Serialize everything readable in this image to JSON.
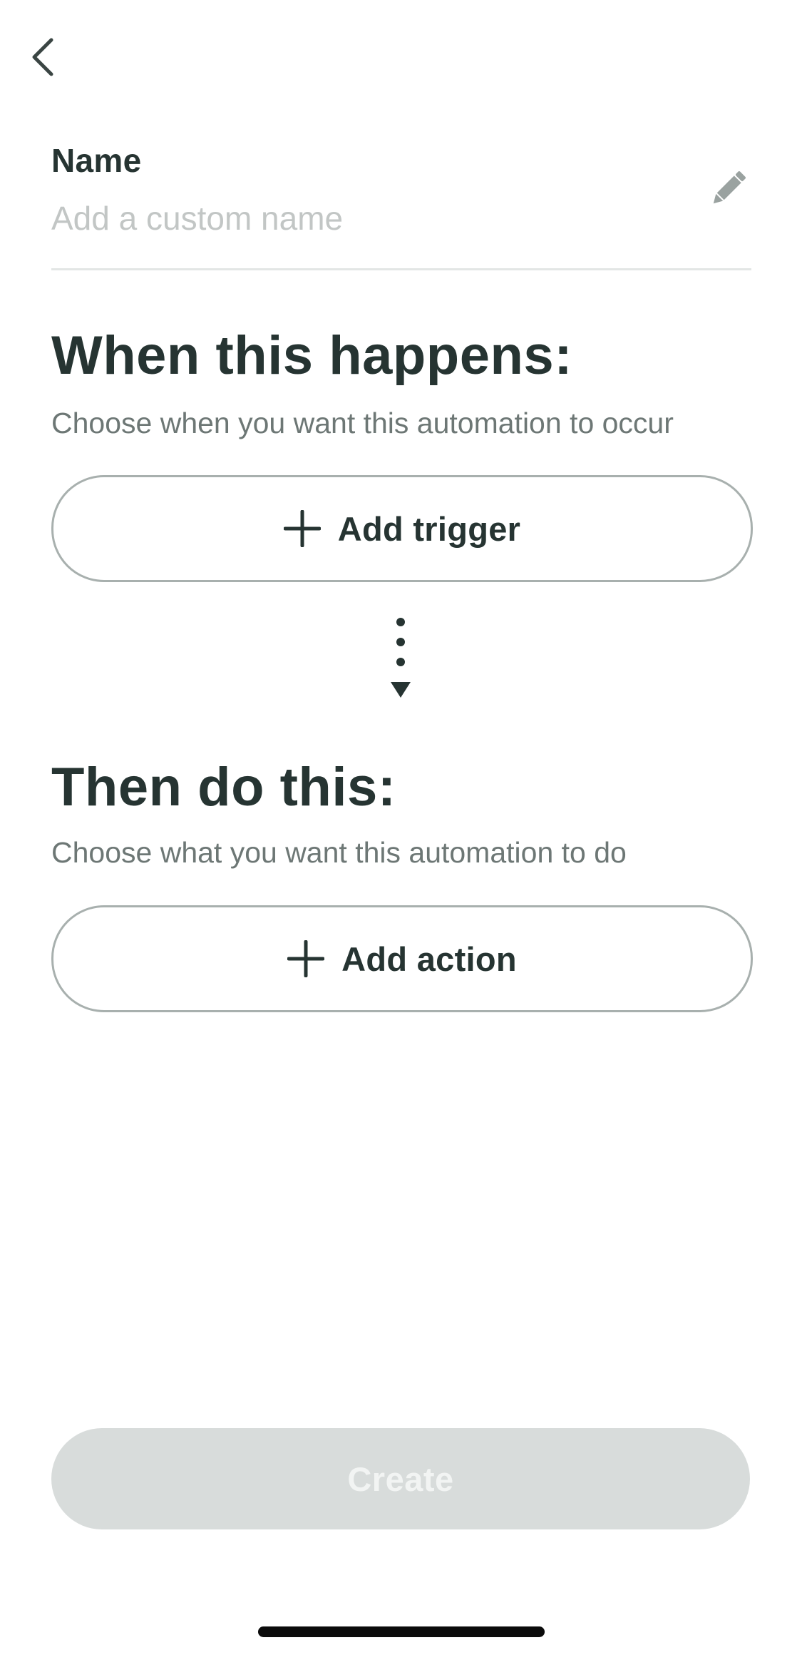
{
  "header": {
    "back_icon": "chevron-left-icon"
  },
  "name_field": {
    "label": "Name",
    "value": "",
    "placeholder": "Add a custom name",
    "edit_icon": "pencil-icon"
  },
  "trigger_section": {
    "heading": "When this happens:",
    "description": "Choose when you want this automation to occur",
    "button_label": "Add trigger",
    "button_icon": "plus-icon"
  },
  "flow_icon": "dotted-arrow-down-icon",
  "action_section": {
    "heading": "Then do this:",
    "description": "Choose what you want this automation to do",
    "button_label": "Add action",
    "button_icon": "plus-icon"
  },
  "footer": {
    "create_label": "Create",
    "create_enabled": false
  },
  "colors": {
    "text_primary": "#263432",
    "text_secondary": "#6d7775",
    "placeholder": "#c2c6c5",
    "button_border": "#a8b0ae",
    "disabled_button_bg": "#d8dcdb",
    "disabled_button_text": "#f2f4f3"
  }
}
